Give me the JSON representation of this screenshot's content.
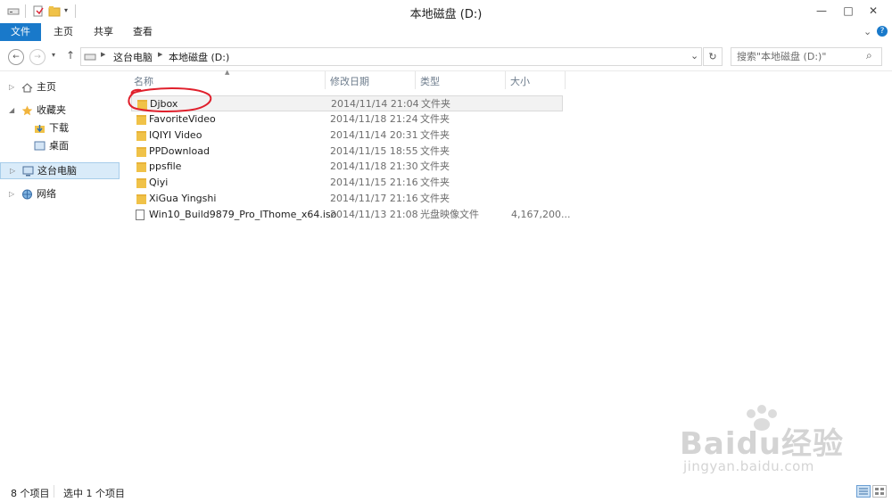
{
  "window": {
    "title": "本地磁盘 (D:)",
    "controls": {
      "minimize": "—",
      "maximize": "□",
      "close": "✕"
    }
  },
  "ribbon": {
    "tabs": [
      "文件",
      "主页",
      "共享",
      "查看"
    ],
    "expand_glyph": "⌄",
    "help_glyph": "?"
  },
  "addressbar": {
    "breadcrumb": [
      "这台电脑",
      "本地磁盘 (D:)"
    ],
    "separator": "▶",
    "dropdown_glyph": "⌄",
    "refresh_glyph": "↻",
    "search_placeholder": "搜索\"本地磁盘 (D:)\"",
    "search_glyph": "⌕"
  },
  "nav": {
    "home": "主页",
    "favorites": "收藏夹",
    "downloads": "下载",
    "desktop": "桌面",
    "thispc": "这台电脑",
    "network": "网络"
  },
  "columns": {
    "name": "名称",
    "modified": "修改日期",
    "type": "类型",
    "size": "大小"
  },
  "files": [
    {
      "name": "Djbox",
      "modified": "2014/11/14 21:04",
      "type": "文件夹",
      "size": "",
      "kind": "folder",
      "selected": true
    },
    {
      "name": "FavoriteVideo",
      "modified": "2014/11/18 21:24",
      "type": "文件夹",
      "size": "",
      "kind": "folder"
    },
    {
      "name": "IQIYI Video",
      "modified": "2014/11/14 20:31",
      "type": "文件夹",
      "size": "",
      "kind": "folder"
    },
    {
      "name": "PPDownload",
      "modified": "2014/11/15 18:55",
      "type": "文件夹",
      "size": "",
      "kind": "folder"
    },
    {
      "name": "ppsfile",
      "modified": "2014/11/18 21:30",
      "type": "文件夹",
      "size": "",
      "kind": "folder"
    },
    {
      "name": "Qiyi",
      "modified": "2014/11/15 21:16",
      "type": "文件夹",
      "size": "",
      "kind": "folder"
    },
    {
      "name": "XiGua Yingshi",
      "modified": "2014/11/17 21:16",
      "type": "文件夹",
      "size": "",
      "kind": "folder"
    },
    {
      "name": "Win10_Build9879_Pro_IThome_x64.iso",
      "modified": "2014/11/13 21:08",
      "type": "光盘映像文件",
      "size": "4,167,200...",
      "kind": "file"
    }
  ],
  "status": {
    "count": "8 个项目",
    "selected": "选中 1 个项目"
  },
  "watermark": {
    "brand": "Baidu经验",
    "url": "jingyan.baidu.com"
  },
  "colors": {
    "file_tab": "#1979ca",
    "selection_nav": "#d9ebf9",
    "annotation": "#e0202c"
  }
}
